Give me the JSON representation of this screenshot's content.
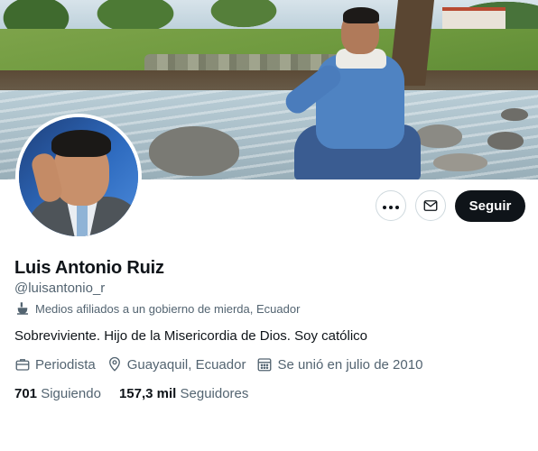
{
  "profile": {
    "name": "Luis Antonio Ruiz",
    "handle": "@luisantonio_r",
    "affiliation_label": "Medios afiliados a un gobierno de mierda, Ecuador",
    "bio": "Sobreviviente. Hijo de la Misericordia de Dios. Soy católico",
    "profession": "Periodista",
    "location": "Guayaquil, Ecuador",
    "joined": "Se unió en julio de 2010"
  },
  "stats": {
    "following_count": "701",
    "following_label": "Siguiendo",
    "followers_count": "157,3 mil",
    "followers_label": "Seguidores"
  },
  "actions": {
    "follow_label": "Seguir",
    "more_icon": "more-icon",
    "message_icon": "mail-icon"
  },
  "icons": {
    "affiliation": "government-affiliation-icon",
    "profession": "briefcase-icon",
    "location": "location-pin-icon",
    "joined": "calendar-icon"
  },
  "colors": {
    "primary_text": "#0f1419",
    "secondary_text": "#536471",
    "follow_button_bg": "#0f1419",
    "border": "#cfd9de"
  }
}
